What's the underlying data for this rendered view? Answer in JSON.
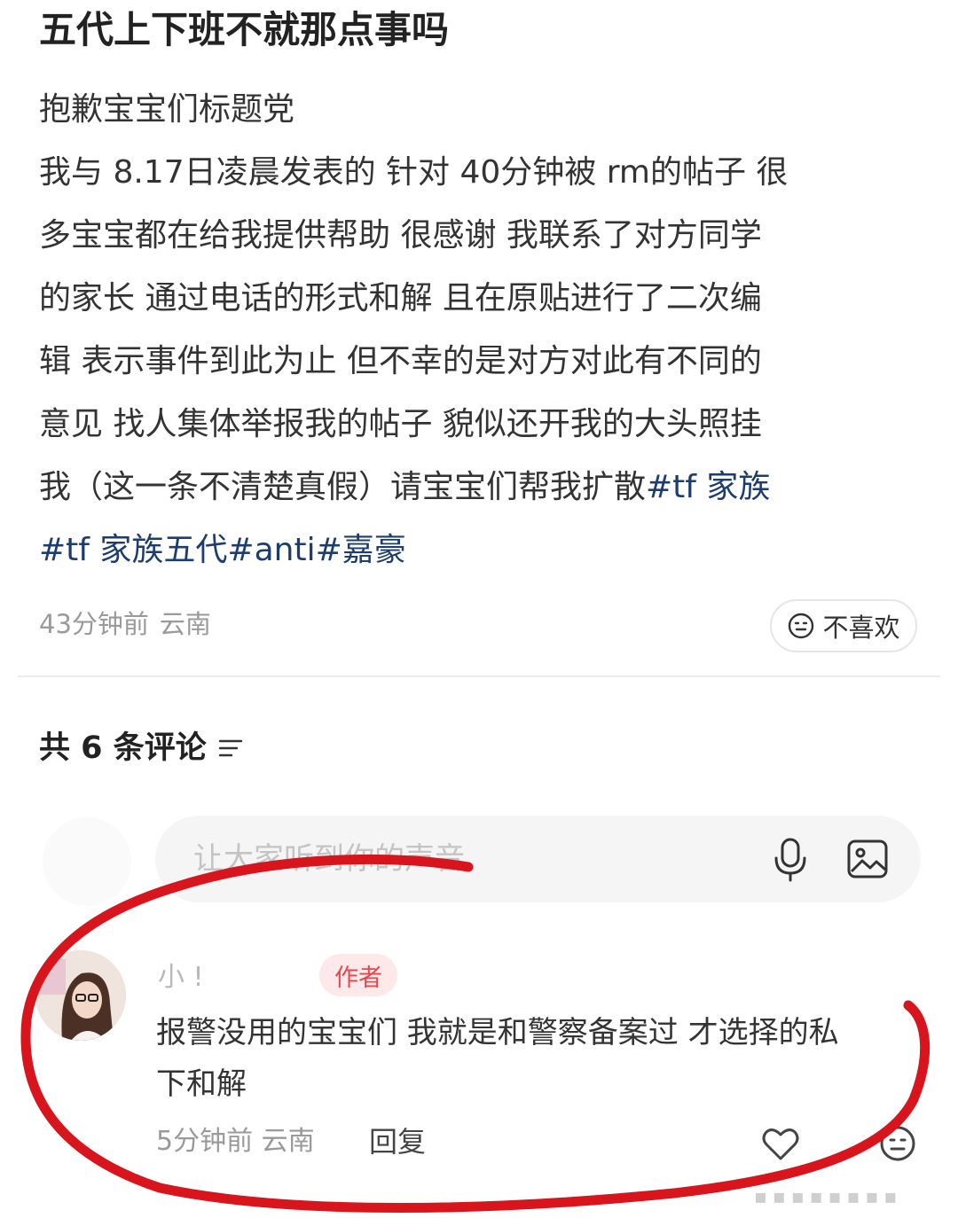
{
  "post": {
    "title": "五代上下班不就那点事吗",
    "lines": [
      "抱歉宝宝们标题党",
      "我与 8.17日凌晨发表的 针对 40分钟被 rm的帖子 很",
      "多宝宝都在给我提供帮助 很感谢 我联系了对方同学",
      "的家长 通过电话的形式和解 且在原贴进行了二次编",
      "辑 表示事件到此为止 但不幸的是对方对此有不同的",
      "意见 找人集体举报我的帖子 貌似还开我的大头照挂",
      "我（这一条不清楚真假）请宝宝们帮我扩散"
    ],
    "tag_inline": "#tf 家族",
    "tags": [
      "#tf 家族五代",
      "#anti",
      "#嘉豪"
    ],
    "time": "43分钟前",
    "location": "云南",
    "dislike_label": "不喜欢"
  },
  "comments_section": {
    "count_label": "共 6 条评论",
    "input_placeholder": "让大家听到你的声音"
  },
  "comment": {
    "author_name": "小        !",
    "author_badge": "作者",
    "text_lines": [
      "报警没用的宝宝们 我就是和警察备案过 才选择的私",
      "下和解"
    ],
    "time": "5分钟前",
    "location": "云南",
    "reply_label": "回复"
  },
  "colors": {
    "tag": "#1d3d6e",
    "badge_bg": "#fde9ea",
    "badge_text": "#e5484d",
    "annotation": "#d8141c"
  },
  "icons": [
    "neutral-face-icon",
    "sort-icon",
    "mic-icon",
    "image-icon",
    "heart-icon",
    "neutral-face-icon"
  ]
}
